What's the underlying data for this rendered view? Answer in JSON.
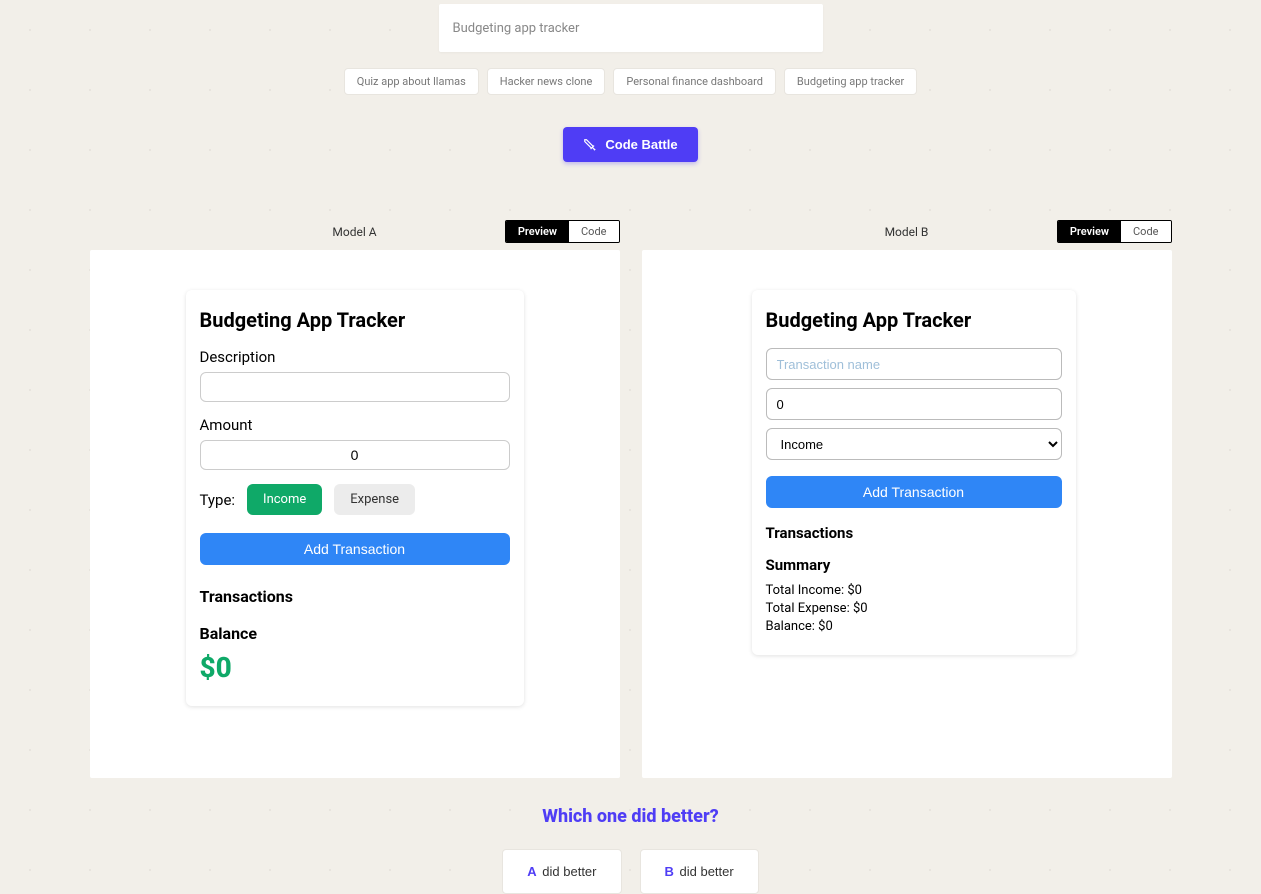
{
  "prompt": {
    "value": "Budgeting app tracker"
  },
  "chips": [
    "Quiz app about llamas",
    "Hacker news clone",
    "Personal finance dashboard",
    "Budgeting app tracker"
  ],
  "battle_button": "Code Battle",
  "panels": {
    "a": {
      "title": "Model A",
      "tabs": {
        "preview": "Preview",
        "code": "Code"
      }
    },
    "b": {
      "title": "Model B",
      "tabs": {
        "preview": "Preview",
        "code": "Code"
      }
    }
  },
  "appA": {
    "title": "Budgeting App Tracker",
    "description_label": "Description",
    "amount_label": "Amount",
    "amount_value": "0",
    "type_label": "Type:",
    "income_label": "Income",
    "expense_label": "Expense",
    "add_button": "Add Transaction",
    "transactions_heading": "Transactions",
    "balance_label": "Balance",
    "balance_value": "$0"
  },
  "appB": {
    "title": "Budgeting App Tracker",
    "name_placeholder": "Transaction name",
    "amount_value": "0",
    "type_selected": "Income",
    "add_button": "Add Transaction",
    "transactions_heading": "Transactions",
    "summary_heading": "Summary",
    "total_income": "Total Income: $0",
    "total_expense": "Total Expense: $0",
    "balance": "Balance: $0"
  },
  "vote": {
    "title": "Which one did better?",
    "a_letter": "A",
    "a_text": " did better",
    "b_letter": "B",
    "b_text": " did better"
  }
}
